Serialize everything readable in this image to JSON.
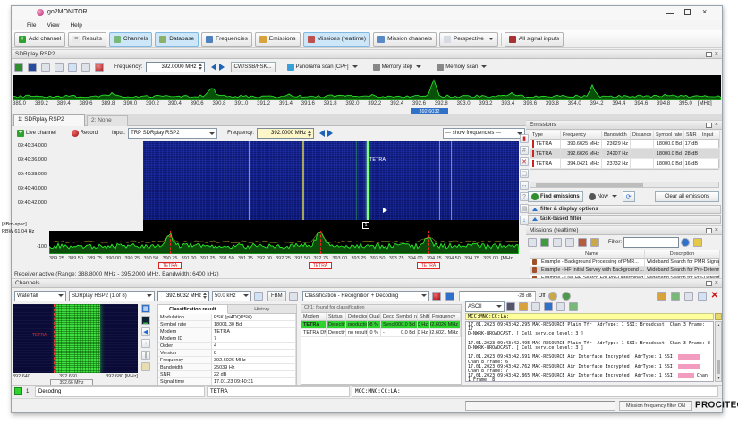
{
  "window": {
    "title": "go2MONITOR"
  },
  "menu": [
    "File",
    "View",
    "Help"
  ],
  "toolbar": {
    "items": [
      {
        "label": "Add channel",
        "icon": "add-channel"
      },
      {
        "label": "Results",
        "icon": "results"
      },
      {
        "label": "Channels",
        "icon": "channels"
      },
      {
        "label": "Database",
        "icon": "database"
      },
      {
        "label": "Frequencies",
        "icon": "frequencies"
      },
      {
        "label": "Emissions",
        "icon": "emissions"
      },
      {
        "label": "Missions (realtime)",
        "icon": "missions"
      },
      {
        "label": "Mission channels",
        "icon": "mission-channels"
      },
      {
        "label": "Perspective",
        "icon": "perspective"
      },
      {
        "label": "All signal inputs",
        "icon": "all-signal-inputs"
      }
    ]
  },
  "icon_styles": {
    "add-channel": {
      "bg": "#2ea12e",
      "glyph": "+",
      "color": "#fff"
    },
    "results": {
      "bg": "#e9e9e9",
      "glyph": "≡",
      "color": "#667"
    },
    "channels": {
      "bg": "#79b879"
    },
    "database": {
      "bg": "#8ab06a"
    },
    "frequencies": {
      "bg": "#4f81bd"
    },
    "emissions": {
      "bg": "#d8a33a"
    },
    "missions": {
      "bg": "#c0504d"
    },
    "mission-channels": {
      "bg": "#5a8ac6"
    },
    "perspective": {
      "bg": "#d5dbe0"
    },
    "all-signal-inputs": {
      "bg": "#a83232"
    }
  },
  "receiver": {
    "panel_title": "SDRplay RSP2",
    "frequency_label": "Frequency:",
    "frequency_value": "392.0000 MHz",
    "demod_button": "CW/SSB/FSK...",
    "panorama_scan": "Panorama scan [CPF]",
    "memory_step": "Memory step",
    "memory_scan": "Memory scan",
    "status": "Receiver active (Range: 388.8000 MHz - 395.2000 MHz, Bandwidth: 6400 kHz)"
  },
  "spectrum_top": {
    "ticks": [
      "389.0",
      "389.2",
      "389.4",
      "389.6",
      "389.8",
      "390.0",
      "390.2",
      "390.4",
      "390.6",
      "390.8",
      "391.0",
      "391.2",
      "391.4",
      "391.6",
      "391.8",
      "392.0",
      "392.2",
      "392.4",
      "392.6",
      "392.8",
      "393.0",
      "393.2",
      "393.4",
      "393.6",
      "393.8",
      "394.0",
      "394.2",
      "394.4",
      "394.6",
      "394.8",
      "395.0"
    ],
    "unit": "[MHz]",
    "marker": "392.6032"
  },
  "tabs": [
    {
      "label": "1: SDRplay RSP2"
    },
    {
      "label": "2: None"
    }
  ],
  "waterfall_bar": {
    "live": "Live channel",
    "record": "Record",
    "input_label": "Input:",
    "input_value": "TRP SDRplay RSP2",
    "frequency_label": "Frequency:",
    "frequency_value": "392.0000 MHz",
    "show_frequencies": "--- show frequencies ---"
  },
  "waterfall": {
    "times": [
      "09:40:34.000",
      "09:40:36.000",
      "09:40:38.000",
      "09:40:40.000",
      "09:40:42.000"
    ],
    "annotation": "TETRA"
  },
  "spectrum_bottom": {
    "scale_label": "[dBm-spec]",
    "rbw_label": "RBW 61.04 Hz",
    "level_label": "-100",
    "ticks": [
      "389.25",
      "389.50",
      "389.75",
      "390.00",
      "390.25",
      "390.50",
      "390.75",
      "391.00",
      "391.25",
      "391.50",
      "391.75",
      "392.00",
      "392.25",
      "392.50",
      "392.75",
      "393.00",
      "393.25",
      "393.50",
      "393.75",
      "394.00",
      "394.25",
      "394.50",
      "394.75",
      "395.00"
    ],
    "unit": "[MHz]"
  },
  "signals": {
    "fmin": 388.8,
    "fmax": 395.2,
    "axis2_fmin": 389.0,
    "axis2_span": 6.25,
    "emissions": [
      {
        "f": 390.6025,
        "snr": 17
      },
      {
        "f": 392.6026,
        "snr": 28
      },
      {
        "f": 394.0421,
        "snr": 16
      }
    ],
    "minor_peaks": [
      {
        "f": 389.7,
        "h": 4
      },
      {
        "f": 391.3,
        "h": 3
      },
      {
        "f": 392.05,
        "h": 3
      },
      {
        "f": 393.3,
        "h": 4
      },
      {
        "f": 394.7,
        "h": 3
      }
    ],
    "marker_label": "TETRA",
    "waterfall_lines": [
      {
        "f": 390.6025,
        "color": "#45e845",
        "w": 1,
        "o": 0.85
      },
      {
        "f": 391.52,
        "color": "#c9c94e",
        "w": 2,
        "o": 0.8
      },
      {
        "f": 391.63,
        "color": "#c9c94e",
        "w": 1,
        "o": 0.55
      },
      {
        "f": 392.42,
        "color": "#3bd13b",
        "w": 1,
        "o": 0.4
      },
      {
        "f": 392.6026,
        "color": "#7dff7d",
        "w": 2,
        "o": 1
      },
      {
        "f": 392.78,
        "color": "#3bd13b",
        "w": 1,
        "o": 0.45
      },
      {
        "f": 393.85,
        "color": "#c9c94e",
        "w": 1,
        "o": 0.7
      },
      {
        "f": 394.0421,
        "color": "#45e845",
        "w": 1,
        "o": 0.8
      },
      {
        "f": 394.95,
        "color": "#3bd13b",
        "w": 1,
        "o": 0.5
      }
    ]
  },
  "emissions_panel": {
    "title": "Emissions",
    "columns": [
      "Type",
      "Frequency",
      "Bandwidth",
      "Distance (km)",
      "Symbol rate",
      "SNR",
      "Input"
    ],
    "rows": [
      {
        "type": "TETRA",
        "frequency": "390.6025 MHz",
        "bandwidth": "23629 Hz",
        "distance": "",
        "symbol_rate": "18000.0 Bd",
        "snr": "17 dB",
        "input": ""
      },
      {
        "type": "TETRA",
        "frequency": "392.6026 MHz",
        "bandwidth": "24207 Hz",
        "distance": "",
        "symbol_rate": "18000.0 Bd",
        "snr": "28 dB",
        "input": ""
      },
      {
        "type": "TETRA",
        "frequency": "394.0421 MHz",
        "bandwidth": "23732 Hz",
        "distance": "",
        "symbol_rate": "18000.0 Bd",
        "snr": "16 dB",
        "input": ""
      }
    ],
    "find_button": "Find emissions",
    "now_button": "Now",
    "clear_button": "Clear all emissions",
    "filter_bar": "filter & display options",
    "task_bar": "task-based filter"
  },
  "missions_panel": {
    "title": "Missions (realtime)",
    "filter_label": "Filter:",
    "columns": [
      "Name",
      "Description"
    ],
    "rows": [
      {
        "name": "Example - Background Processing of PMR...",
        "description": "Wideband Search for PMR Signal Typ..."
      },
      {
        "name": "Example - HF Initial Survey with Background ...",
        "description": "Wideband Search for Pre-Determined ..."
      },
      {
        "name": "Example - Live HF Search For Pre-Determined ...",
        "description": "Wideband Search for Pre-Determined ..."
      }
    ]
  },
  "channels_panel": {
    "title": "Channels",
    "view": "Waterfall",
    "source": "SDRplay RSP2 (1 of 8)",
    "frequency": "392.6032 MHz",
    "bandwidth": "50.0 kHz",
    "mode_button": "FBM",
    "task": "Classification - Recognition + Decoding",
    "level": "-28 dB",
    "off_label": "Off"
  },
  "channel_view": {
    "ticks": [
      "392.640",
      "392.660",
      "392.680"
    ],
    "unit": "[MHz]",
    "marker": "TETRA",
    "center_label": "392.66 MHz"
  },
  "classification": {
    "tab_result": "Classification result",
    "tab_history": "History",
    "rows": [
      {
        "label": "Modulation",
        "value": "PSK (pi4DQPSK)"
      },
      {
        "label": "Symbol rate",
        "value": "18001.30 Bd"
      },
      {
        "label": "Modem",
        "value": "TETRA"
      },
      {
        "label": "Modem ID",
        "value": "7"
      },
      {
        "label": "Order",
        "value": "4"
      },
      {
        "label": "Version",
        "value": "8"
      },
      {
        "label": "Frequency",
        "value": "392.6026 MHz"
      },
      {
        "label": "Bandwidth",
        "value": "25039 Hz"
      },
      {
        "label": "SNR",
        "value": "22 dB"
      },
      {
        "label": "Signal time",
        "value": "17.01.23 09:40:31"
      }
    ]
  },
  "modems": {
    "title": "Ch1: found for classification",
    "columns": [
      "Modem",
      "Status",
      "Detection",
      "Quality",
      "Decoder",
      "Symbol rate",
      "Shift",
      "Frequency"
    ],
    "rows": [
      {
        "modem": "TETRA",
        "status": "Detecting",
        "detection": "production",
        "quality": "98 %",
        "decoder": "Sync",
        "symbol_rate": "18000.0 Bd",
        "shift": "0.0 Hz",
        "frequency": "392.6026 MHz"
      },
      {
        "modem": "TETRA DMO",
        "status": "Detecting",
        "detection": "no result",
        "quality": "0 %",
        "decoder": "-",
        "symbol_rate": "0.0 Bd",
        "shift": "0.0 Hz",
        "frequency": "392.6021 MHz"
      }
    ]
  },
  "decoder": {
    "alphabet": "ASCII",
    "header_segments": [
      {
        "text": "MCC: "
      },
      {
        "text": "    ",
        "redacted": true
      },
      {
        "text": "  MNC: "
      },
      {
        "text": "     ",
        "redacted": true
      },
      {
        "text": "  CC: "
      },
      {
        "text": "   ",
        "redacted": true
      },
      {
        "text": "  LA: "
      },
      {
        "text": "     ",
        "redacted": true
      }
    ],
    "lines": [
      [
        {
          "text": "17.01.2023 09:43:42.295 MAC-RESOURCE Plain Tfr  AdrType: 1 SSI: Broadcast  Chan 3 Frame: 17"
        }
      ],
      [
        {
          "text": "D-NWRK-BROADCAST. [ Cell service level: 3 ]"
        }
      ],
      [
        {
          "text": " "
        }
      ],
      [
        {
          "text": "17.01.2023 09:43:42.495 MAC-RESOURCE Plain Tfr  AdrType: 1 SSI: Broadcast  Chan 3 Frame: 8"
        }
      ],
      [
        {
          "text": "D-NWRK-BROADCAST. [ Cell service level: 3 ]"
        }
      ],
      [
        {
          "text": " "
        }
      ],
      [
        {
          "text": "17.01.2023 09:43:42.691 MAC-RESOURCE Air Interface Encrypted  AdrType: 1 SSI: "
        },
        {
          "text": "        ",
          "redacted": true
        },
        {
          "text": " Chan 8 Frame: 6"
        }
      ],
      [
        {
          "text": "17.01.2023 09:43:42.762 MAC-RESOURCE Air Interface Encrypted  AdrType: 1 SSI: "
        },
        {
          "text": "        ",
          "redacted": true
        },
        {
          "text": " Chan 8 Frame: 7"
        }
      ],
      [
        {
          "text": "17.01.2023 09:43:42.865 MAC-RESOURCE Air Interface Encrypted  AdrType: 1 SSI: "
        },
        {
          "text": "      ",
          "redacted": true
        },
        {
          "text": " Chan 1 Frame: 8"
        }
      ]
    ]
  },
  "channel_row": {
    "number": "1",
    "status": "Decoding",
    "modem": "TETRA",
    "info_segments": [
      {
        "text": "MCC: "
      },
      {
        "text": "    ",
        "redacted": true
      },
      {
        "text": " MNC: "
      },
      {
        "text": "     ",
        "redacted": true
      },
      {
        "text": " CC: "
      },
      {
        "text": "   ",
        "redacted": true
      },
      {
        "text": " LA: "
      },
      {
        "text": "     ",
        "redacted": true
      }
    ]
  },
  "statusbar": {
    "filter_status": "Mission frequency filter ON",
    "logo": "PROCITEC",
    "logo_mark": "®"
  }
}
